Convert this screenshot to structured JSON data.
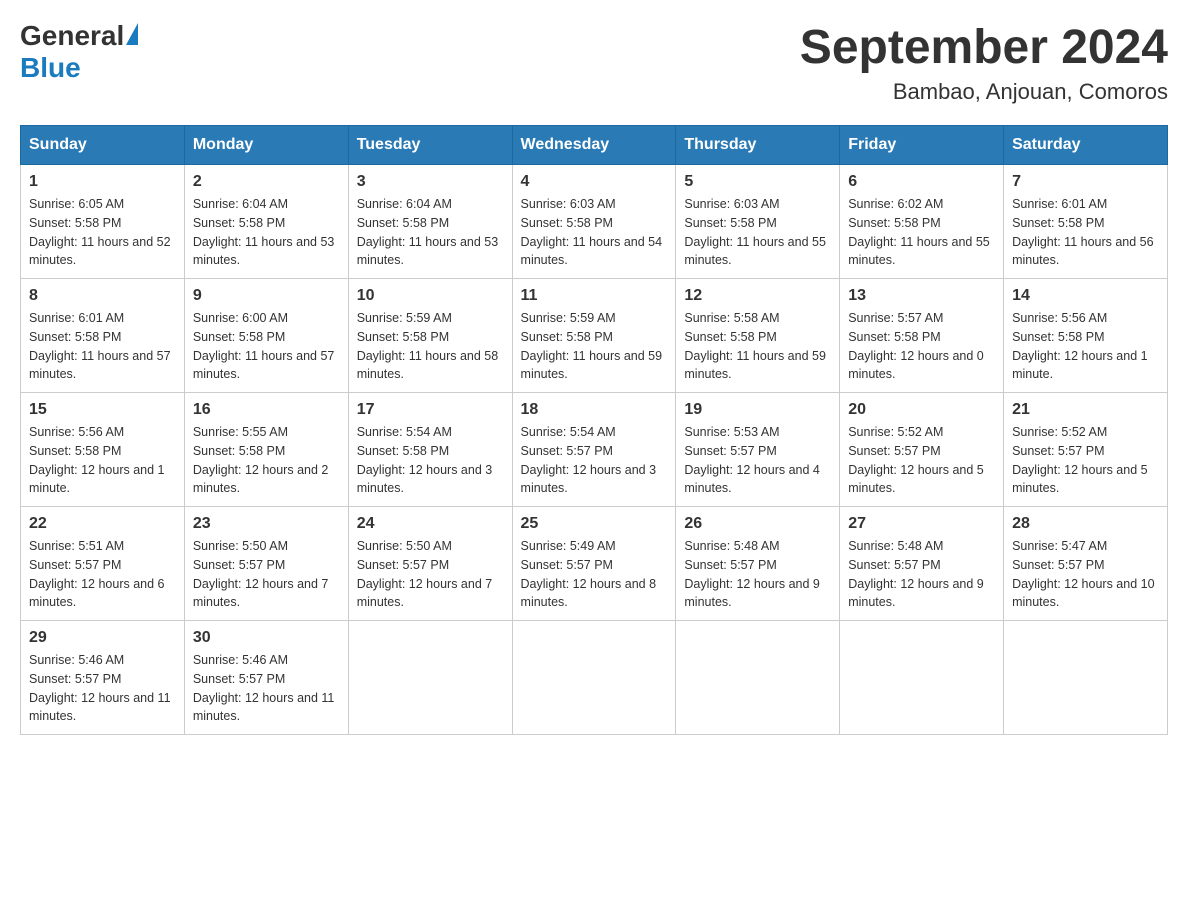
{
  "header": {
    "logo_general": "General",
    "logo_blue": "Blue",
    "month_title": "September 2024",
    "location": "Bambao, Anjouan, Comoros"
  },
  "days_of_week": [
    "Sunday",
    "Monday",
    "Tuesday",
    "Wednesday",
    "Thursday",
    "Friday",
    "Saturday"
  ],
  "weeks": [
    [
      {
        "day": "1",
        "sunrise": "6:05 AM",
        "sunset": "5:58 PM",
        "daylight": "11 hours and 52 minutes."
      },
      {
        "day": "2",
        "sunrise": "6:04 AM",
        "sunset": "5:58 PM",
        "daylight": "11 hours and 53 minutes."
      },
      {
        "day": "3",
        "sunrise": "6:04 AM",
        "sunset": "5:58 PM",
        "daylight": "11 hours and 53 minutes."
      },
      {
        "day": "4",
        "sunrise": "6:03 AM",
        "sunset": "5:58 PM",
        "daylight": "11 hours and 54 minutes."
      },
      {
        "day": "5",
        "sunrise": "6:03 AM",
        "sunset": "5:58 PM",
        "daylight": "11 hours and 55 minutes."
      },
      {
        "day": "6",
        "sunrise": "6:02 AM",
        "sunset": "5:58 PM",
        "daylight": "11 hours and 55 minutes."
      },
      {
        "day": "7",
        "sunrise": "6:01 AM",
        "sunset": "5:58 PM",
        "daylight": "11 hours and 56 minutes."
      }
    ],
    [
      {
        "day": "8",
        "sunrise": "6:01 AM",
        "sunset": "5:58 PM",
        "daylight": "11 hours and 57 minutes."
      },
      {
        "day": "9",
        "sunrise": "6:00 AM",
        "sunset": "5:58 PM",
        "daylight": "11 hours and 57 minutes."
      },
      {
        "day": "10",
        "sunrise": "5:59 AM",
        "sunset": "5:58 PM",
        "daylight": "11 hours and 58 minutes."
      },
      {
        "day": "11",
        "sunrise": "5:59 AM",
        "sunset": "5:58 PM",
        "daylight": "11 hours and 59 minutes."
      },
      {
        "day": "12",
        "sunrise": "5:58 AM",
        "sunset": "5:58 PM",
        "daylight": "11 hours and 59 minutes."
      },
      {
        "day": "13",
        "sunrise": "5:57 AM",
        "sunset": "5:58 PM",
        "daylight": "12 hours and 0 minutes."
      },
      {
        "day": "14",
        "sunrise": "5:56 AM",
        "sunset": "5:58 PM",
        "daylight": "12 hours and 1 minute."
      }
    ],
    [
      {
        "day": "15",
        "sunrise": "5:56 AM",
        "sunset": "5:58 PM",
        "daylight": "12 hours and 1 minute."
      },
      {
        "day": "16",
        "sunrise": "5:55 AM",
        "sunset": "5:58 PM",
        "daylight": "12 hours and 2 minutes."
      },
      {
        "day": "17",
        "sunrise": "5:54 AM",
        "sunset": "5:58 PM",
        "daylight": "12 hours and 3 minutes."
      },
      {
        "day": "18",
        "sunrise": "5:54 AM",
        "sunset": "5:57 PM",
        "daylight": "12 hours and 3 minutes."
      },
      {
        "day": "19",
        "sunrise": "5:53 AM",
        "sunset": "5:57 PM",
        "daylight": "12 hours and 4 minutes."
      },
      {
        "day": "20",
        "sunrise": "5:52 AM",
        "sunset": "5:57 PM",
        "daylight": "12 hours and 5 minutes."
      },
      {
        "day": "21",
        "sunrise": "5:52 AM",
        "sunset": "5:57 PM",
        "daylight": "12 hours and 5 minutes."
      }
    ],
    [
      {
        "day": "22",
        "sunrise": "5:51 AM",
        "sunset": "5:57 PM",
        "daylight": "12 hours and 6 minutes."
      },
      {
        "day": "23",
        "sunrise": "5:50 AM",
        "sunset": "5:57 PM",
        "daylight": "12 hours and 7 minutes."
      },
      {
        "day": "24",
        "sunrise": "5:50 AM",
        "sunset": "5:57 PM",
        "daylight": "12 hours and 7 minutes."
      },
      {
        "day": "25",
        "sunrise": "5:49 AM",
        "sunset": "5:57 PM",
        "daylight": "12 hours and 8 minutes."
      },
      {
        "day": "26",
        "sunrise": "5:48 AM",
        "sunset": "5:57 PM",
        "daylight": "12 hours and 9 minutes."
      },
      {
        "day": "27",
        "sunrise": "5:48 AM",
        "sunset": "5:57 PM",
        "daylight": "12 hours and 9 minutes."
      },
      {
        "day": "28",
        "sunrise": "5:47 AM",
        "sunset": "5:57 PM",
        "daylight": "12 hours and 10 minutes."
      }
    ],
    [
      {
        "day": "29",
        "sunrise": "5:46 AM",
        "sunset": "5:57 PM",
        "daylight": "12 hours and 11 minutes."
      },
      {
        "day": "30",
        "sunrise": "5:46 AM",
        "sunset": "5:57 PM",
        "daylight": "12 hours and 11 minutes."
      },
      null,
      null,
      null,
      null,
      null
    ]
  ],
  "labels": {
    "sunrise": "Sunrise:",
    "sunset": "Sunset:",
    "daylight": "Daylight:"
  }
}
